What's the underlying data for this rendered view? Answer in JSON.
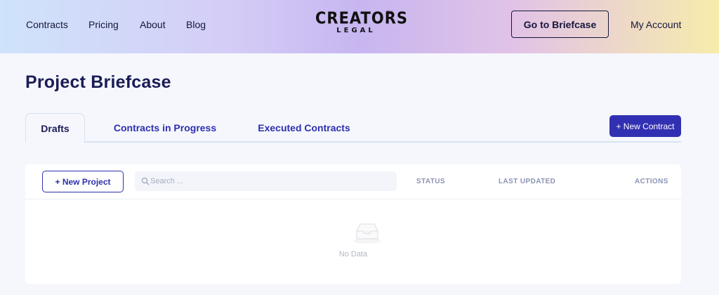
{
  "header": {
    "nav": [
      "Contracts",
      "Pricing",
      "About",
      "Blog"
    ],
    "logo": {
      "line1": "CREATORS",
      "line2": "LEGAL",
      "tm": "TM"
    },
    "go_briefcase_label": "Go to Briefcase",
    "account_label": "My Account"
  },
  "page": {
    "title": "Project Briefcase"
  },
  "tabs": [
    {
      "label": "Drafts",
      "active": true
    },
    {
      "label": "Contracts in Progress",
      "active": false
    },
    {
      "label": "Executed Contracts",
      "active": false
    }
  ],
  "new_contract_label": "+ New Contract",
  "table": {
    "new_project_label": "+ New Project",
    "search_placeholder": "Search ...",
    "columns": [
      "STATUS",
      "LAST UPDATED",
      "ACTIONS"
    ],
    "empty_text": "No Data"
  },
  "colors": {
    "primary": "#3230b2",
    "title": "#1b1c55",
    "background": "#f5f7fd"
  },
  "icons": {
    "search": "search-icon",
    "empty": "empty-inbox-icon"
  }
}
